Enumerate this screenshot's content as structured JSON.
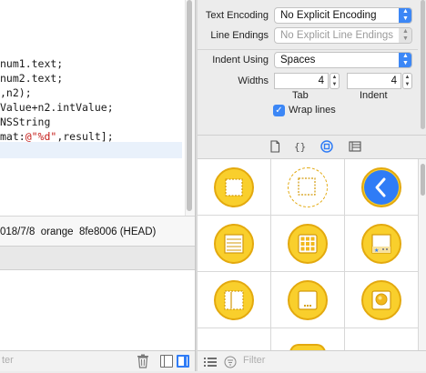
{
  "editor": {
    "lines": [
      {
        "segments": [
          {
            "text": "num1.text;",
            "cls": ""
          }
        ]
      },
      {
        "segments": [
          {
            "text": "num2.text;",
            "cls": ""
          }
        ]
      },
      {
        "segments": [
          {
            "text": ",n2);",
            "cls": ""
          }
        ]
      },
      {
        "segments": [
          {
            "text": "Value+n2.intValue;",
            "cls": ""
          }
        ]
      },
      {
        "segments": [
          {
            "text": "NSString",
            "cls": ""
          }
        ]
      },
      {
        "segments": [
          {
            "text": "mat:",
            "cls": ""
          },
          {
            "text": "@\"%d\"",
            "cls": "str"
          },
          {
            "text": ",result];",
            "cls": ""
          }
        ]
      }
    ],
    "blame": "018/7/8  orange  8fe8006 (HEAD)"
  },
  "left_bottom": {
    "filter_placeholder": "ter"
  },
  "inspector": {
    "text_encoding": {
      "label": "Text Encoding",
      "value": "No Explicit Encoding"
    },
    "line_endings": {
      "label": "Line Endings",
      "value": "No Explicit Line Endings"
    },
    "indent_using": {
      "label": "Indent Using",
      "value": "Spaces"
    },
    "widths": {
      "label": "Widths",
      "tab_value": "4",
      "tab_label": "Tab",
      "indent_value": "4",
      "indent_label": "Indent"
    },
    "wrap_lines": {
      "label": "Wrap lines",
      "checked": true
    }
  },
  "library": {
    "tabs": [
      {
        "name": "file-template-tab-icon"
      },
      {
        "name": "code-snippet-tab-icon"
      },
      {
        "name": "object-library-tab-icon",
        "selected": true
      },
      {
        "name": "media-library-tab-icon"
      }
    ],
    "items": [
      "view-controller-icon",
      "storyboard-reference-icon",
      "navigation-controller-icon",
      "table-view-controller-icon",
      "collection-view-controller-icon",
      "tab-bar-controller-icon",
      "split-view-controller-icon",
      "page-view-controller-icon",
      "glkit-view-controller-icon",
      "avkit-player-icon",
      "object-icon",
      "empty-icon"
    ],
    "filter_placeholder": "Filter"
  },
  "colors": {
    "accent": "#3c87f6",
    "library_icon_fill": "#f9cf2c",
    "library_icon_stroke": "#e3a90e",
    "string_literal": "#c41a16"
  }
}
